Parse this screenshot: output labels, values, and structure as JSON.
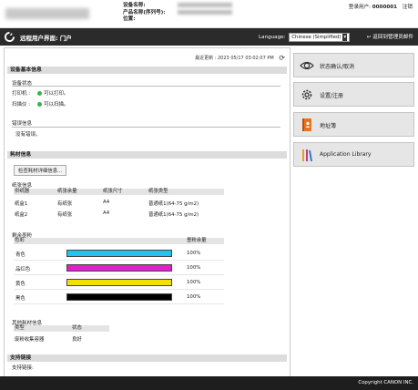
{
  "header": {
    "device_name_label": "设备名称:",
    "product_name_label": "产品名称(序列号):",
    "location_label": "位置:",
    "login_user_label": "登录用户:",
    "login_user_value": "0000001",
    "logout_label": "注销"
  },
  "nav": {
    "title": "远程用户界面: 门户",
    "language_label": "Language:",
    "language_value": "Chinese (Simplified)",
    "back_label": "返回到管理员邮件"
  },
  "status": {
    "last_update_label": "最近更新 : 2023 05/17 03:02:07 PM"
  },
  "basic_info": {
    "header": "设备基本信息",
    "device_status_label": "设备状态",
    "printer_label": "打印机 :",
    "printer_status": "可以打印。",
    "scanner_label": "扫描仪 :",
    "scanner_status": "可以扫描。",
    "error_label": "错误信息",
    "error_value": "没有错误。"
  },
  "consumables": {
    "header": "耗材信息",
    "detail_button": "检查耗材详细信息...",
    "paper_label": "纸张信息",
    "paper_columns": [
      "供纸器",
      "纸张余量",
      "纸张尺寸",
      "纸张类型"
    ],
    "paper_rows": [
      [
        "纸盒1",
        "有纸张",
        "A4",
        "普通纸1(64-75 g/m2)"
      ],
      [
        "纸盒2",
        "有纸张",
        "A4",
        "普通纸1(64-75 g/m2)"
      ]
    ],
    "toner_label": "剩余墨粉",
    "toner_columns": [
      "色彩",
      "墨粉余量"
    ],
    "toner_rows": [
      {
        "name": "青色",
        "value": "100%",
        "level": 100,
        "color": "#22c4ee"
      },
      {
        "name": "品红色",
        "value": "100%",
        "level": 100,
        "color": "#e020c8"
      },
      {
        "name": "黄色",
        "value": "100%",
        "level": 100,
        "color": "#f4e000"
      },
      {
        "name": "黑色",
        "value": "100%",
        "level": 100,
        "color": "#000000"
      }
    ],
    "other_label": "其他耗材信息",
    "other_columns": [
      "类型",
      "状态"
    ],
    "other_rows": [
      [
        "废粉收集容器",
        "良好"
      ]
    ]
  },
  "support": {
    "header": "支持链接",
    "link_label": "支持链接:"
  },
  "shortcuts": [
    {
      "label": "状态确认/取消",
      "icon": "eye-icon"
    },
    {
      "label": "设置/注册",
      "icon": "gear-icon"
    },
    {
      "label": "地址簿",
      "icon": "address-book-icon"
    },
    {
      "label": "Application Library",
      "icon": "library-icon"
    }
  ],
  "footer": {
    "copyright": "Copyright CANON INC."
  }
}
